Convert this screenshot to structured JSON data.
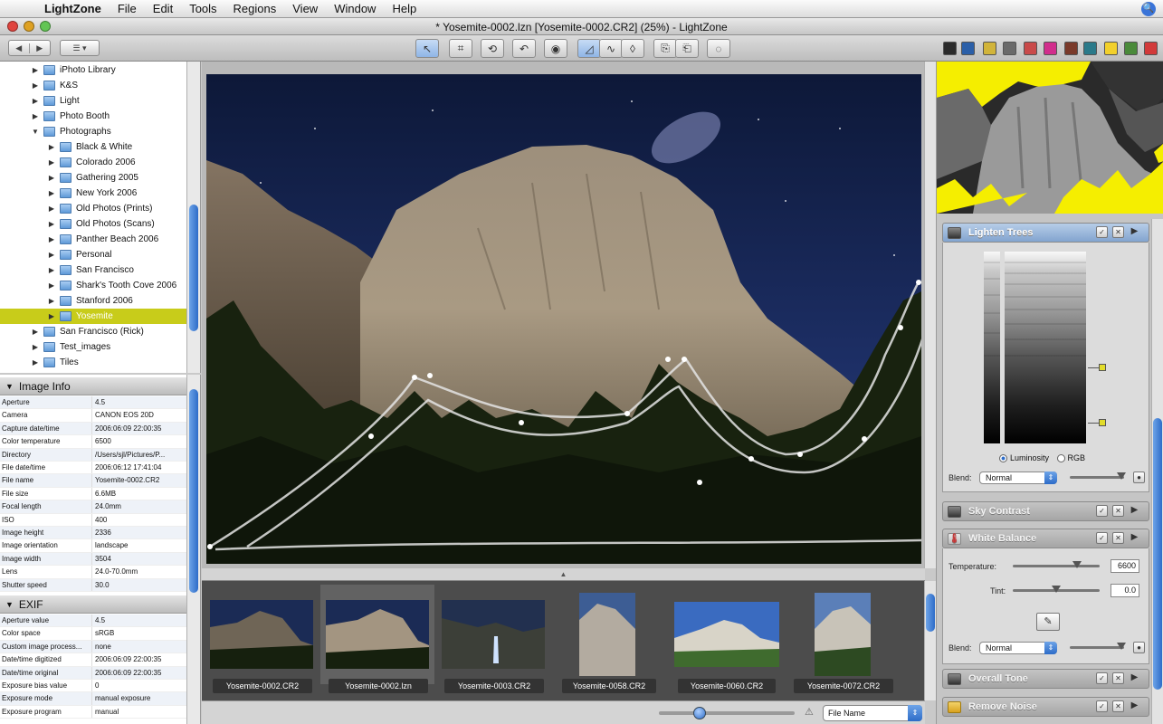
{
  "menubar": {
    "app": "LightZone",
    "items": [
      "File",
      "Edit",
      "Tools",
      "Regions",
      "View",
      "Window",
      "Help"
    ]
  },
  "window": {
    "title": "* Yosemite-0002.lzn [Yosemite-0002.CR2] (25%) - LightZone"
  },
  "toolbar": {
    "back": "◀",
    "forward": "▶",
    "view_menu": "☰ ▾",
    "tools": [
      "arrow-icon",
      "crop-icon",
      "rotate-icon",
      "undo-redo-icon",
      "eye-icon",
      "region-poly-icon",
      "region-spline-icon",
      "region-freehand-icon",
      "copy-icon",
      "paste-icon",
      "clear-icon"
    ],
    "swatches": [
      "#2b2b2b",
      "#2b5fa8",
      "#d1b43a",
      "#6a6a6a",
      "#c94a4a",
      "#d12d8c",
      "#7a3a2a",
      "#2b7a8a",
      "#f2d02b",
      "#4a8a3a",
      "#d23a3a"
    ]
  },
  "tree": {
    "items": [
      {
        "label": "iPhoto Library",
        "level": 1,
        "selected": false
      },
      {
        "label": "K&S",
        "level": 1,
        "selected": false
      },
      {
        "label": "Light",
        "level": 1,
        "selected": false
      },
      {
        "label": "Photo Booth",
        "level": 1,
        "selected": false
      },
      {
        "label": "Photographs",
        "level": 1,
        "selected": false,
        "open": true
      },
      {
        "label": "Black & White",
        "level": 2,
        "selected": false
      },
      {
        "label": "Colorado 2006",
        "level": 2,
        "selected": false
      },
      {
        "label": "Gathering 2005",
        "level": 2,
        "selected": false
      },
      {
        "label": "New York 2006",
        "level": 2,
        "selected": false
      },
      {
        "label": "Old Photos (Prints)",
        "level": 2,
        "selected": false
      },
      {
        "label": "Old Photos (Scans)",
        "level": 2,
        "selected": false
      },
      {
        "label": "Panther Beach 2006",
        "level": 2,
        "selected": false
      },
      {
        "label": "Personal",
        "level": 2,
        "selected": false
      },
      {
        "label": "San Francisco",
        "level": 2,
        "selected": false
      },
      {
        "label": "Shark's Tooth Cove 2006",
        "level": 2,
        "selected": false
      },
      {
        "label": "Stanford 2006",
        "level": 2,
        "selected": false
      },
      {
        "label": "Yosemite",
        "level": 2,
        "selected": true
      },
      {
        "label": "San Francisco (Rick)",
        "level": 1,
        "selected": false
      },
      {
        "label": "Test_images",
        "level": 1,
        "selected": false
      },
      {
        "label": "Tiles",
        "level": 1,
        "selected": false
      }
    ]
  },
  "image_info": {
    "header": "Image Info",
    "rows": [
      [
        "Aperture",
        "4.5"
      ],
      [
        "Camera",
        "CANON EOS 20D"
      ],
      [
        "Capture date/time",
        "2006:06:09 22:00:35"
      ],
      [
        "Color temperature",
        "6500"
      ],
      [
        "Directory",
        "/Users/sjl/Pictures/P..."
      ],
      [
        "File date/time",
        "2006:06:12 17:41:04"
      ],
      [
        "File name",
        "Yosemite-0002.CR2"
      ],
      [
        "File size",
        "6.6MB"
      ],
      [
        "Focal length",
        "24.0mm"
      ],
      [
        "ISO",
        "400"
      ],
      [
        "Image height",
        "2336"
      ],
      [
        "Image orientation",
        "landscape"
      ],
      [
        "Image width",
        "3504"
      ],
      [
        "Lens",
        "24.0-70.0mm"
      ],
      [
        "Shutter speed",
        "30.0"
      ]
    ]
  },
  "exif": {
    "header": "EXIF",
    "rows": [
      [
        "Aperture value",
        "4.5"
      ],
      [
        "Color space",
        "sRGB"
      ],
      [
        "Custom image process...",
        "none"
      ],
      [
        "Date/time digitized",
        "2006:06:09 22:00:35"
      ],
      [
        "Date/time original",
        "2006:06:09 22:00:35"
      ],
      [
        "Exposure bias value",
        "0"
      ],
      [
        "Exposure mode",
        "manual exposure"
      ],
      [
        "Exposure program",
        "manual"
      ]
    ]
  },
  "filmstrip": {
    "thumbs": [
      {
        "label": "Yosemite-0002.CR2",
        "selected": false
      },
      {
        "label": "Yosemite-0002.lzn",
        "selected": true
      },
      {
        "label": "Yosemite-0003.CR2",
        "selected": false
      },
      {
        "label": "Yosemite-0058.CR2",
        "selected": false
      },
      {
        "label": "Yosemite-0060.CR2",
        "selected": false
      },
      {
        "label": "Yosemite-0072.CR2",
        "selected": false
      }
    ],
    "sort": "File Name",
    "size_value": 0.3
  },
  "tools_panel": {
    "lighten_trees": {
      "title": "Lighten Trees",
      "mode_luminosity": "Luminosity",
      "mode_rgb": "RGB",
      "blend_label": "Blend:",
      "blend_value": "Normal"
    },
    "sky_contrast": {
      "title": "Sky Contrast"
    },
    "white_balance": {
      "title": "White Balance",
      "temperature_label": "Temperature:",
      "temperature_value": "6600",
      "tint_label": "Tint:",
      "tint_value": "0.0",
      "blend_label": "Blend:",
      "blend_value": "Normal"
    },
    "overall_tone": {
      "title": "Overall Tone"
    },
    "remove_noise": {
      "title": "Remove Noise"
    }
  },
  "colors": {
    "selection": "#c8cc1a",
    "accent": "#2d6cc8",
    "zone_highlight": "#f5ee00"
  }
}
